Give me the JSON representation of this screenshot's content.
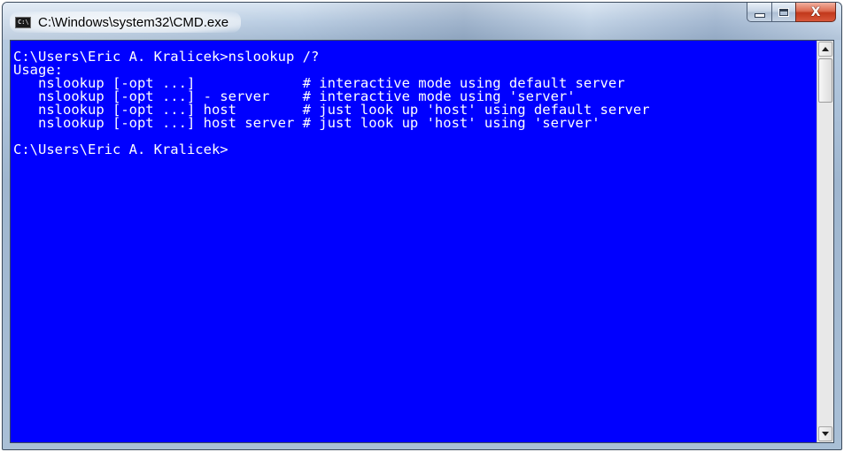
{
  "window": {
    "title": "C:\\Windows\\system32\\CMD.exe",
    "app_icon_text": "C:\\",
    "icons": {
      "app": "cmd-app-icon",
      "minimize": "minimize-icon",
      "maximize": "maximize-icon",
      "close": "close-icon"
    },
    "close_glyph": "X"
  },
  "console": {
    "background_color": "#0000ff",
    "text_color": "#ffffff",
    "lines": [
      "C:\\Users\\Eric A. Kralicek>nslookup /?",
      "Usage:",
      "   nslookup [-opt ...]             # interactive mode using default server",
      "   nslookup [-opt ...] - server    # interactive mode using 'server'",
      "   nslookup [-opt ...] host        # just look up 'host' using default server",
      "   nslookup [-opt ...] host server # just look up 'host' using 'server'",
      "",
      "C:\\Users\\Eric A. Kralicek>"
    ]
  },
  "scrollbar": {
    "up_icon": "scroll-up-arrow-icon",
    "down_icon": "scroll-down-arrow-icon",
    "position_fraction": 0.0
  }
}
